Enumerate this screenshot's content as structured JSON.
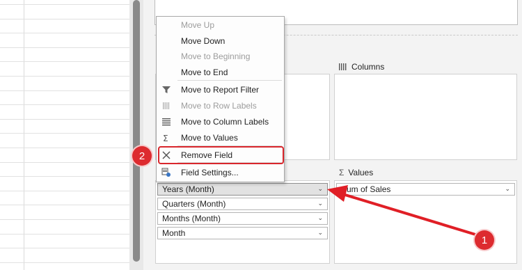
{
  "menu": {
    "items": [
      {
        "label": "Move Up",
        "disabled": true,
        "icon": "none"
      },
      {
        "label": "Move Down",
        "disabled": false,
        "icon": "none"
      },
      {
        "label": "Move to Beginning",
        "disabled": true,
        "icon": "none"
      },
      {
        "label": "Move to End",
        "disabled": false,
        "icon": "none"
      },
      {
        "label": "Move to Report Filter",
        "disabled": false,
        "icon": "filter-icon"
      },
      {
        "label": "Move to Row Labels",
        "disabled": true,
        "icon": "rows-icon"
      },
      {
        "label": "Move to Column Labels",
        "disabled": false,
        "icon": "columns-icon"
      },
      {
        "label": "Move to Values",
        "disabled": false,
        "icon": "sigma-icon"
      },
      {
        "label": "Remove Field",
        "disabled": false,
        "icon": "remove-icon"
      },
      {
        "label": "Field Settings...",
        "disabled": false,
        "icon": "field-settings-icon"
      }
    ]
  },
  "areas": {
    "columns_label": "Columns",
    "values_label": "Values",
    "values_sigma": "Σ",
    "rows_fields": [
      "Years (Month)",
      "Quarters (Month)",
      "Months (Month)",
      "Month"
    ],
    "values_fields": [
      "Sum of Sales"
    ]
  },
  "annotations": {
    "badge1": "1",
    "badge2": "2",
    "accent_color": "#dd2b2f"
  }
}
